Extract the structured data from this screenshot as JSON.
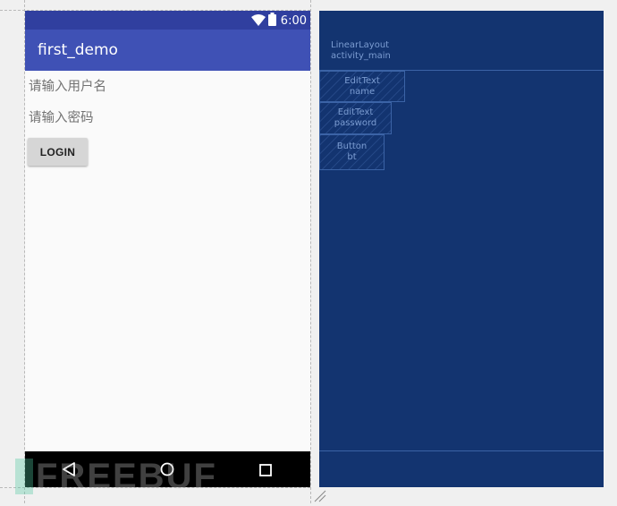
{
  "status_bar": {
    "time": "6:00",
    "wifi_icon": "wifi-icon",
    "battery_icon": "battery-icon"
  },
  "app_bar": {
    "title": "first_demo"
  },
  "form": {
    "name_hint": "请输入用户名",
    "password_hint": "请输入密码",
    "login_label": "LOGIN"
  },
  "nav_bar": {
    "back_icon": "back-icon",
    "home_icon": "home-icon",
    "recents_icon": "recents-icon"
  },
  "blueprint": {
    "root": {
      "type": "LinearLayout",
      "id": "activity_main"
    },
    "children": [
      {
        "type": "EditText",
        "id": "name"
      },
      {
        "type": "EditText",
        "id": "password"
      },
      {
        "type": "Button",
        "id": "bt"
      }
    ]
  },
  "watermark": "FREEBUF",
  "colors": {
    "status_bar": "#303f9f",
    "app_bar": "#3f51b5",
    "blueprint_bg": "#133470",
    "blueprint_text": "#7b9cd1",
    "button_bg": "#d6d6d6"
  }
}
